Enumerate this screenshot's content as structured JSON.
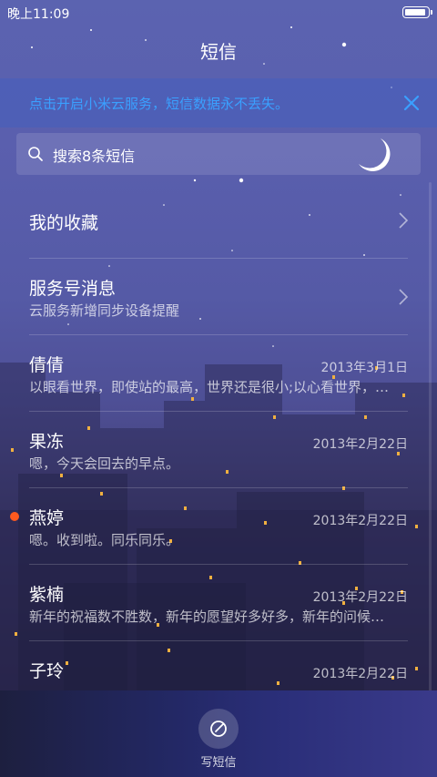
{
  "status_bar": {
    "time": "晚上11:09"
  },
  "header": {
    "title": "短信"
  },
  "banner": {
    "text": "点击开启小米云服务，短信数据永不丢失。"
  },
  "search": {
    "placeholder": "搜索8条短信"
  },
  "pinned": [
    {
      "title": "我的收藏",
      "subtitle": ""
    },
    {
      "title": "服务号消息",
      "subtitle": "云服务新增同步设备提醒"
    }
  ],
  "conversations": [
    {
      "name": "倩倩",
      "date": "2013年3月1日",
      "preview": "以眼看世界，即使站的最高，世界还是很小;以心看世界，…",
      "unread": false
    },
    {
      "name": "果冻",
      "date": "2013年2月22日",
      "preview": "嗯，今天会回去的早点。",
      "unread": false
    },
    {
      "name": "燕婷",
      "date": "2013年2月22日",
      "preview": "嗯。收到啦。同乐同乐。",
      "unread": true
    },
    {
      "name": "紫楠",
      "date": "2013年2月22日",
      "preview": "新年的祝福数不胜数，新年的愿望好多好多，新年的问候…",
      "unread": false
    },
    {
      "name": "子玲",
      "date": "2013年2月22日",
      "preview": "",
      "unread": false
    }
  ],
  "bottom": {
    "compose_label": "写短信"
  },
  "colors": {
    "accent": "#3aa0ff",
    "unread": "#ff5a1f"
  }
}
